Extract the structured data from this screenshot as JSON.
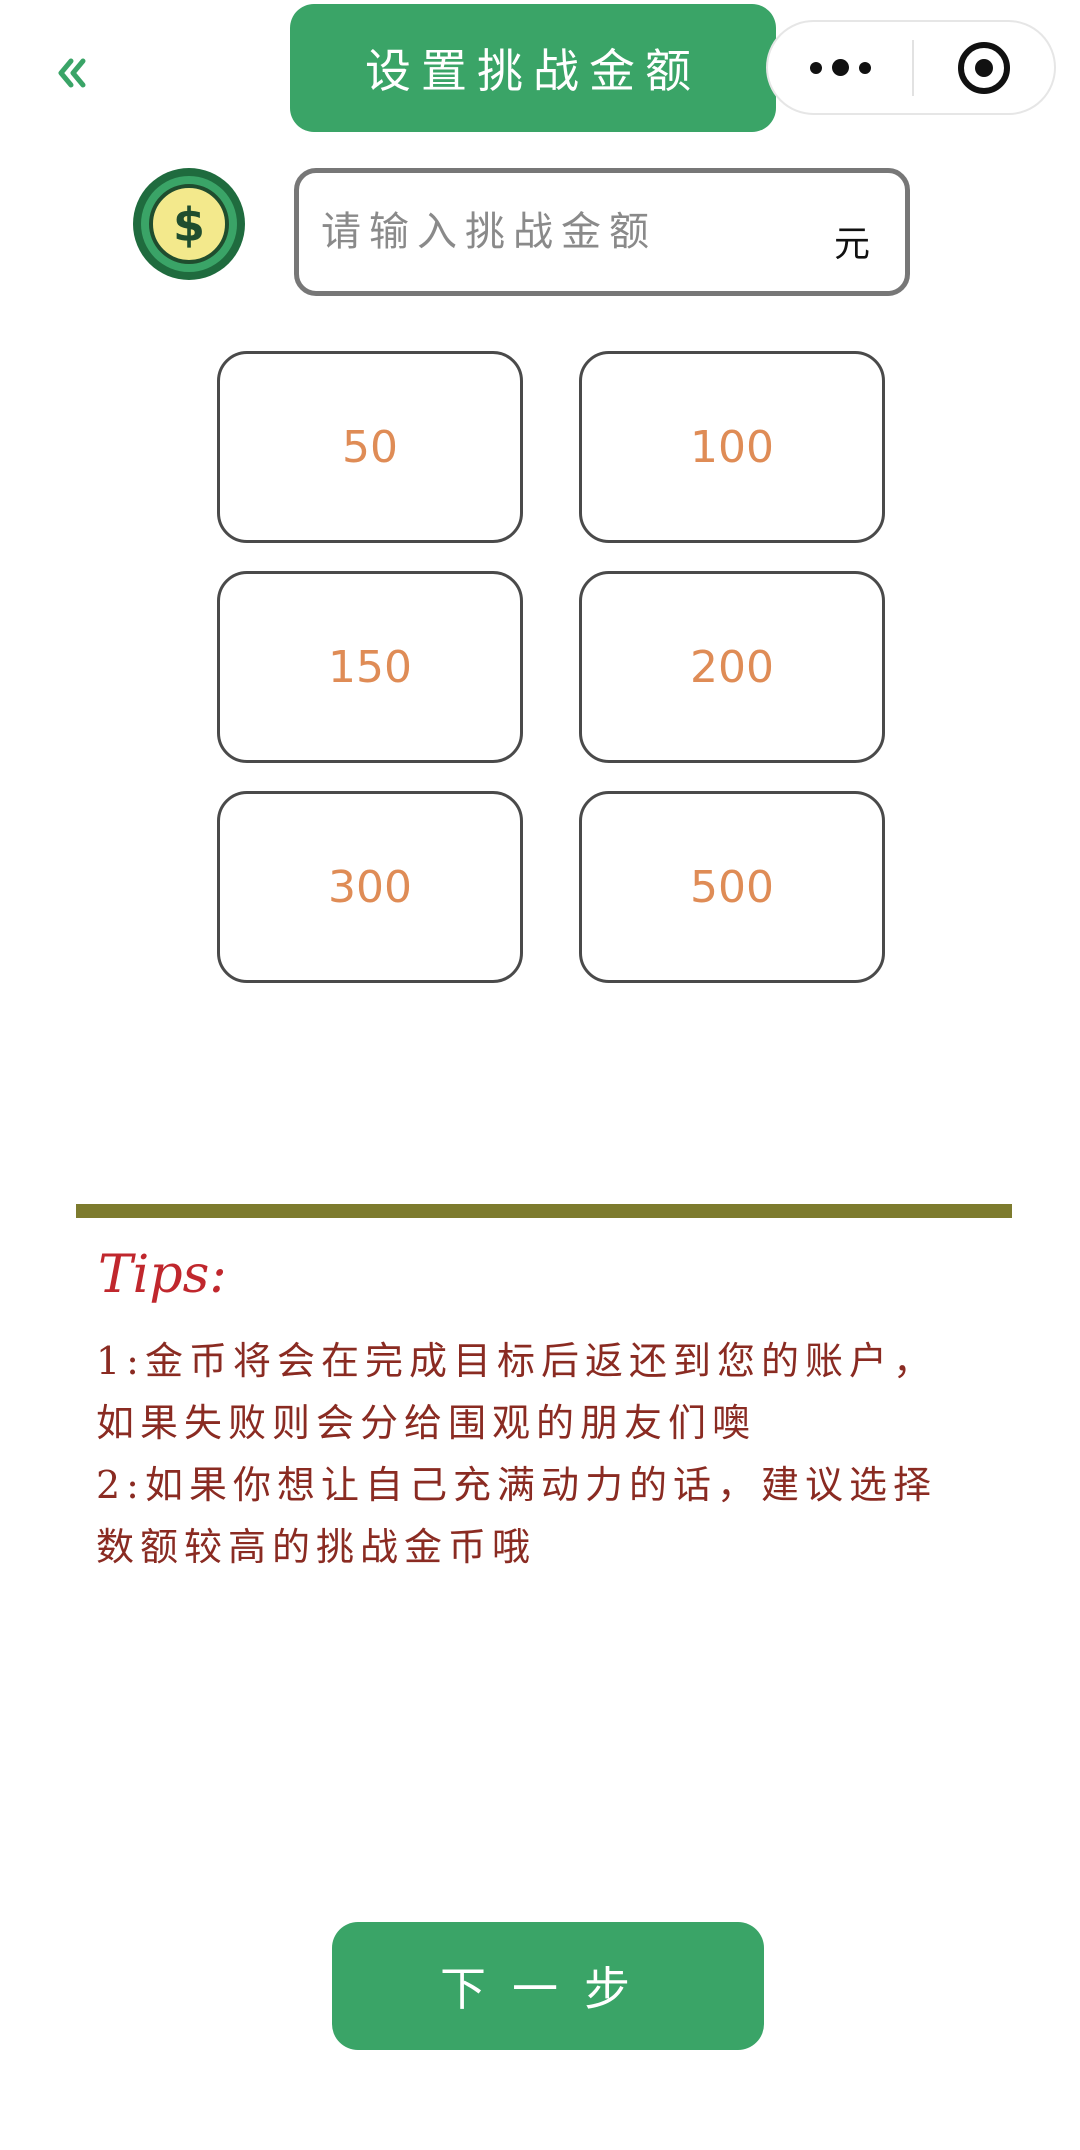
{
  "header": {
    "title": "设置挑战金额",
    "back_icon": "double-chevron-left-icon",
    "more_icon": "more-dots-icon",
    "target_icon": "target-icon"
  },
  "amount": {
    "placeholder": "请输入挑战金额",
    "value": "",
    "unit": "元",
    "icon": "dollar-coin-icon"
  },
  "presets": [
    "50",
    "100",
    "150",
    "200",
    "300",
    "500"
  ],
  "tips": {
    "title": "Tips:",
    "line1": "1:金币将会在完成目标后返还到您的账户，如果失败则会分给围观的朋友们噢",
    "line2": "2:如果你想让自己充满动力的话，建议选择数额较高的挑战金币哦"
  },
  "next_label": "下一步",
  "colors": {
    "primary_green": "#3aa467",
    "preset_text": "#df8c56",
    "tips_title": "#c0272d",
    "tips_text": "#8a2b22",
    "rule": "#7d7b2e"
  }
}
